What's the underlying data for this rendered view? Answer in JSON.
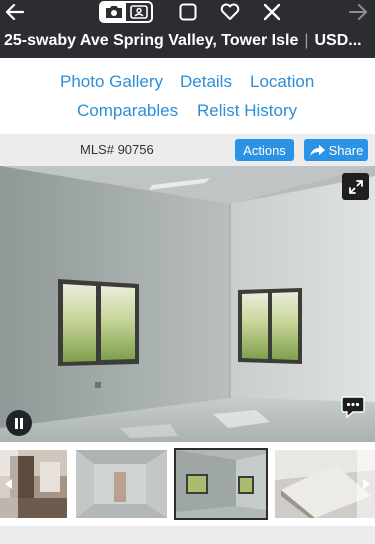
{
  "header": {
    "address": "25-swaby Ave Spring Valley, Tower Isle",
    "separator": "|",
    "price": "USD..."
  },
  "tabs": [
    "Photo Gallery",
    "Details",
    "Location",
    "Comparables",
    "Relist History"
  ],
  "listing_bar": {
    "mls": "MLS# 90756",
    "actions_label": "Actions",
    "share_label": "Share"
  },
  "icons": {
    "back": "arrow-left-icon",
    "camera": "camera-icon",
    "contact": "contact-card-icon",
    "square": "square-icon",
    "favorite": "heart-icon",
    "close": "close-icon",
    "forward": "arrow-right-icon",
    "expand": "expand-icon",
    "pause": "pause-icon",
    "chat": "chat-bubble-icon"
  },
  "colors": {
    "header_bg": "#2b2d30",
    "link_blue": "#2a8fd8",
    "button_blue": "#2a93e6",
    "bar_gray": "#ececec"
  }
}
